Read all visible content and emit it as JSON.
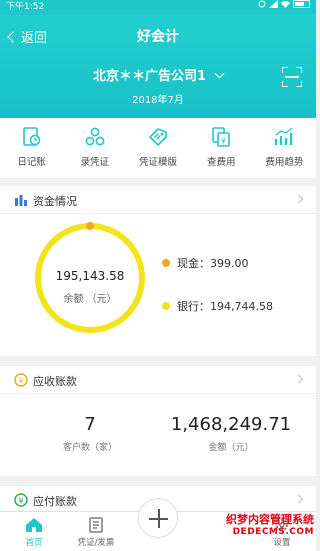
{
  "status_bar": {
    "time": "下午1:52"
  },
  "header": {
    "back_label": "返回",
    "title": "好会计",
    "company": "北京＊＊广告公司1",
    "period": "2018年7月"
  },
  "shortcuts": [
    {
      "label": "日记账",
      "icon": "journal-icon"
    },
    {
      "label": "录凭证",
      "icon": "voucher-entry-icon"
    },
    {
      "label": "凭证模版",
      "icon": "voucher-template-icon"
    },
    {
      "label": "查费用",
      "icon": "expense-icon"
    },
    {
      "label": "费用趋势",
      "icon": "trend-icon"
    }
  ],
  "funds": {
    "title": "资金情况",
    "balance_value": "195,143.58",
    "balance_label": "余额 （元）",
    "cash_label": "现金：399.00",
    "bank_label": "银行：194,744.58",
    "cash_value": 399.0,
    "bank_value": 194744.58,
    "colors": {
      "cash": "#f2a623",
      "bank": "#f2e31b"
    }
  },
  "receivables": {
    "title": "应收账款",
    "customers_value": "7",
    "customers_label": "客户数（家）",
    "amount_value": "1,468,249.71",
    "amount_label": "金额（元）"
  },
  "payables": {
    "title": "应付账款"
  },
  "tabbar": {
    "home": "首页",
    "vouchers": "凭证/发票",
    "settings": "设置"
  },
  "watermark": {
    "line1": "织梦内容管理系统",
    "line2": "DEDECMS.COM"
  },
  "accent_color": "#1ec8c9"
}
